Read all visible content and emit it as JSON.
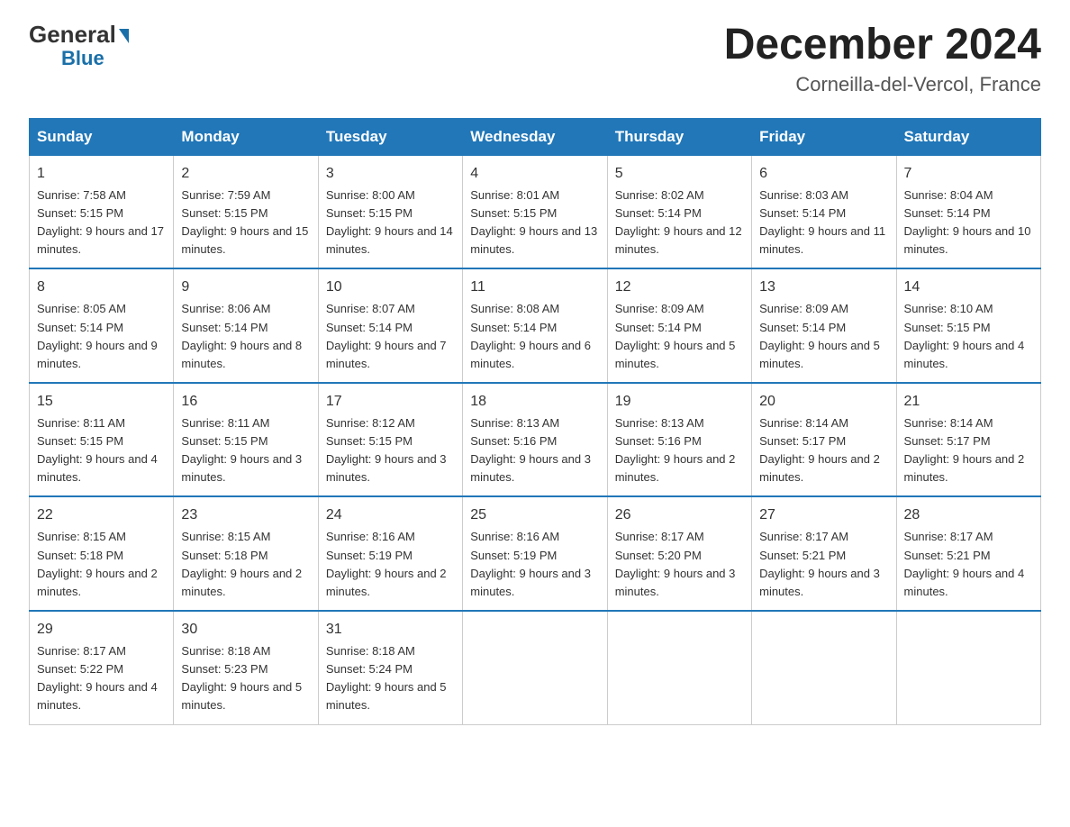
{
  "logo": {
    "general": "General",
    "triangle": "▶",
    "blue": "Blue"
  },
  "title": "December 2024",
  "location": "Corneilla-del-Vercol, France",
  "days_of_week": [
    "Sunday",
    "Monday",
    "Tuesday",
    "Wednesday",
    "Thursday",
    "Friday",
    "Saturday"
  ],
  "weeks": [
    [
      {
        "day": "1",
        "sunrise": "7:58 AM",
        "sunset": "5:15 PM",
        "daylight": "9 hours and 17 minutes."
      },
      {
        "day": "2",
        "sunrise": "7:59 AM",
        "sunset": "5:15 PM",
        "daylight": "9 hours and 15 minutes."
      },
      {
        "day": "3",
        "sunrise": "8:00 AM",
        "sunset": "5:15 PM",
        "daylight": "9 hours and 14 minutes."
      },
      {
        "day": "4",
        "sunrise": "8:01 AM",
        "sunset": "5:15 PM",
        "daylight": "9 hours and 13 minutes."
      },
      {
        "day": "5",
        "sunrise": "8:02 AM",
        "sunset": "5:14 PM",
        "daylight": "9 hours and 12 minutes."
      },
      {
        "day": "6",
        "sunrise": "8:03 AM",
        "sunset": "5:14 PM",
        "daylight": "9 hours and 11 minutes."
      },
      {
        "day": "7",
        "sunrise": "8:04 AM",
        "sunset": "5:14 PM",
        "daylight": "9 hours and 10 minutes."
      }
    ],
    [
      {
        "day": "8",
        "sunrise": "8:05 AM",
        "sunset": "5:14 PM",
        "daylight": "9 hours and 9 minutes."
      },
      {
        "day": "9",
        "sunrise": "8:06 AM",
        "sunset": "5:14 PM",
        "daylight": "9 hours and 8 minutes."
      },
      {
        "day": "10",
        "sunrise": "8:07 AM",
        "sunset": "5:14 PM",
        "daylight": "9 hours and 7 minutes."
      },
      {
        "day": "11",
        "sunrise": "8:08 AM",
        "sunset": "5:14 PM",
        "daylight": "9 hours and 6 minutes."
      },
      {
        "day": "12",
        "sunrise": "8:09 AM",
        "sunset": "5:14 PM",
        "daylight": "9 hours and 5 minutes."
      },
      {
        "day": "13",
        "sunrise": "8:09 AM",
        "sunset": "5:14 PM",
        "daylight": "9 hours and 5 minutes."
      },
      {
        "day": "14",
        "sunrise": "8:10 AM",
        "sunset": "5:15 PM",
        "daylight": "9 hours and 4 minutes."
      }
    ],
    [
      {
        "day": "15",
        "sunrise": "8:11 AM",
        "sunset": "5:15 PM",
        "daylight": "9 hours and 4 minutes."
      },
      {
        "day": "16",
        "sunrise": "8:11 AM",
        "sunset": "5:15 PM",
        "daylight": "9 hours and 3 minutes."
      },
      {
        "day": "17",
        "sunrise": "8:12 AM",
        "sunset": "5:15 PM",
        "daylight": "9 hours and 3 minutes."
      },
      {
        "day": "18",
        "sunrise": "8:13 AM",
        "sunset": "5:16 PM",
        "daylight": "9 hours and 3 minutes."
      },
      {
        "day": "19",
        "sunrise": "8:13 AM",
        "sunset": "5:16 PM",
        "daylight": "9 hours and 2 minutes."
      },
      {
        "day": "20",
        "sunrise": "8:14 AM",
        "sunset": "5:17 PM",
        "daylight": "9 hours and 2 minutes."
      },
      {
        "day": "21",
        "sunrise": "8:14 AM",
        "sunset": "5:17 PM",
        "daylight": "9 hours and 2 minutes."
      }
    ],
    [
      {
        "day": "22",
        "sunrise": "8:15 AM",
        "sunset": "5:18 PM",
        "daylight": "9 hours and 2 minutes."
      },
      {
        "day": "23",
        "sunrise": "8:15 AM",
        "sunset": "5:18 PM",
        "daylight": "9 hours and 2 minutes."
      },
      {
        "day": "24",
        "sunrise": "8:16 AM",
        "sunset": "5:19 PM",
        "daylight": "9 hours and 2 minutes."
      },
      {
        "day": "25",
        "sunrise": "8:16 AM",
        "sunset": "5:19 PM",
        "daylight": "9 hours and 3 minutes."
      },
      {
        "day": "26",
        "sunrise": "8:17 AM",
        "sunset": "5:20 PM",
        "daylight": "9 hours and 3 minutes."
      },
      {
        "day": "27",
        "sunrise": "8:17 AM",
        "sunset": "5:21 PM",
        "daylight": "9 hours and 3 minutes."
      },
      {
        "day": "28",
        "sunrise": "8:17 AM",
        "sunset": "5:21 PM",
        "daylight": "9 hours and 4 minutes."
      }
    ],
    [
      {
        "day": "29",
        "sunrise": "8:17 AM",
        "sunset": "5:22 PM",
        "daylight": "9 hours and 4 minutes."
      },
      {
        "day": "30",
        "sunrise": "8:18 AM",
        "sunset": "5:23 PM",
        "daylight": "9 hours and 5 minutes."
      },
      {
        "day": "31",
        "sunrise": "8:18 AM",
        "sunset": "5:24 PM",
        "daylight": "9 hours and 5 minutes."
      },
      null,
      null,
      null,
      null
    ]
  ]
}
